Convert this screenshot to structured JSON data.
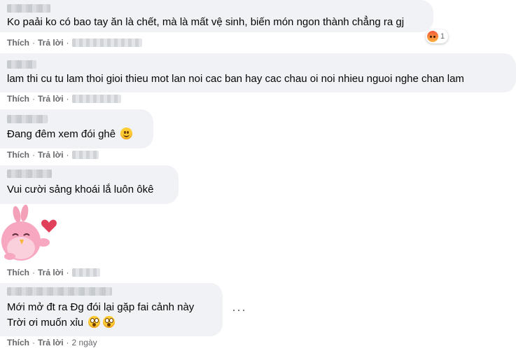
{
  "actions": {
    "like": "Thích",
    "reply": "Trả lời",
    "separator": "·"
  },
  "comments": [
    {
      "text": "Ko paải ko có bao tay ăn là chết, mà là mất vệ sinh, biến món ngon thành chẳng ra gj",
      "reaction": {
        "icon": "angry-reaction-icon",
        "count": "1"
      }
    },
    {
      "text": "lam thi cu tu lam thoi gioi thieu mot lan noi cac ban hay cac chau oi noi nhieu nguoi nghe chan lam"
    },
    {
      "text": "Đang đêm xem đói ghê",
      "emoji": "slightly-smiling-face-icon"
    },
    {
      "text": "Vui cười sảng khoái lắ luôn ôkê"
    },
    {
      "sticker": "pink-bird-heart-sticker"
    },
    {
      "lines": [
        "Mới mở đt ra Đg đói lại gặp fai cảnh này",
        "Trời ơi muốn xỉu"
      ],
      "emoji": "astonished-face-icon",
      "time": "2 ngày"
    }
  ],
  "more_options": "···",
  "colors": {
    "bubble": "#f0f2f5",
    "secondary_text": "#65676b",
    "text": "#050505"
  }
}
